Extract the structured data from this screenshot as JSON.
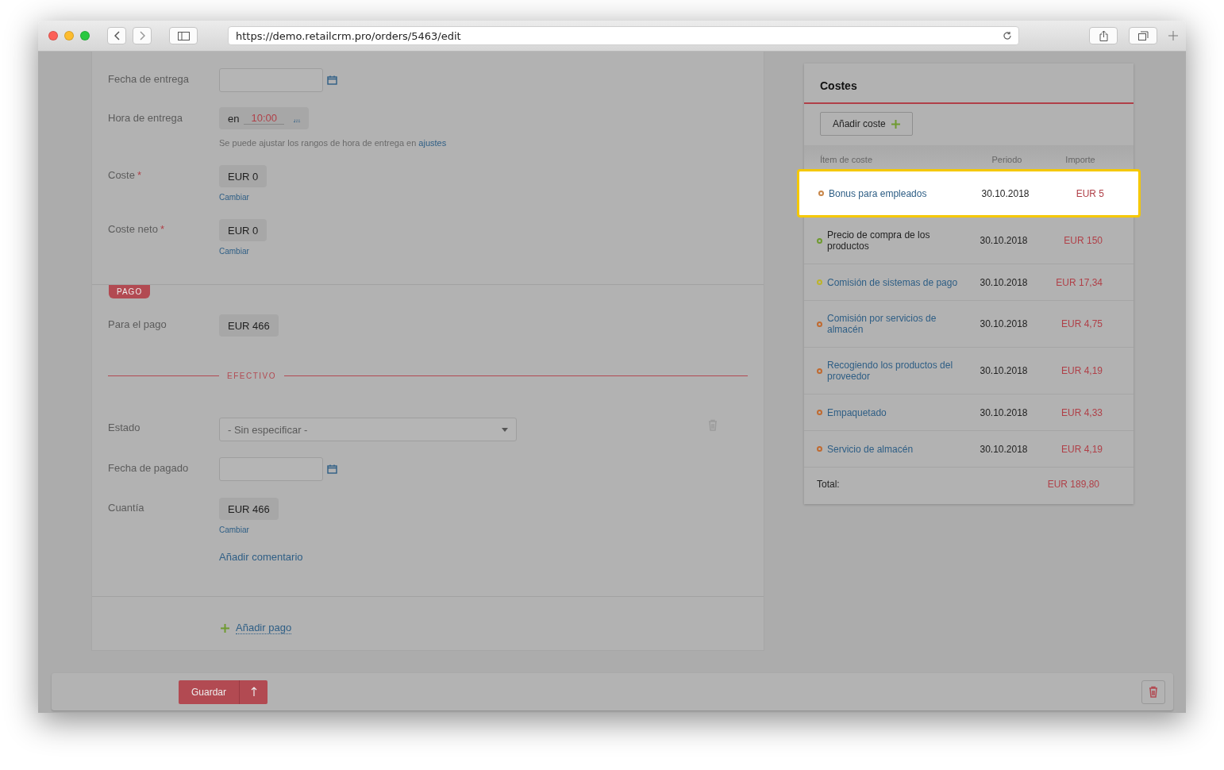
{
  "browser": {
    "url": "https://demo.retailcrm.pro/orders/5463/edit"
  },
  "delivery": [
    {
      "kind": "date",
      "label": "Fecha de entrega"
    },
    {
      "kind": "time",
      "label": "Hora de entrega",
      "prefix": "en",
      "value": "10:00",
      "more": "...",
      "hint": "Se puede ajustar los rangos de hora de entrega en",
      "hint_link": "ajustes"
    },
    {
      "kind": "money",
      "label": "Coste",
      "required_mark": "*",
      "value": "EUR 0",
      "action": "Cambiar"
    },
    {
      "kind": "money",
      "label": "Coste neto",
      "required_mark": "*",
      "value": "EUR 0",
      "action": "Cambiar"
    }
  ],
  "payment": {
    "tag": "PAGO",
    "summary": [
      {
        "kind": "money",
        "label": "Para el pago",
        "value": "EUR 466"
      }
    ],
    "method": "EFECTIVO",
    "fields": [
      {
        "kind": "select",
        "label": "Estado",
        "value": "- Sin especificar -"
      },
      {
        "kind": "date",
        "label": "Fecha de pagado"
      },
      {
        "kind": "money",
        "label": "Cuantía",
        "value": "EUR 466",
        "action": "Cambiar"
      }
    ],
    "comment_link": "Añadir comentario",
    "add_payment": "Añadir pago"
  },
  "costs": {
    "title": "Costes",
    "add_button": "Añadir coste",
    "columns": [
      "Ítem de coste",
      "Periodo",
      "Importe"
    ],
    "rows": [
      {
        "kind": "link",
        "name": "Bonus para empleados",
        "period": "30.10.2018",
        "amount": "EUR 5",
        "color": "#c8874a",
        "selected": true
      },
      {
        "kind": "text",
        "name": "Precio de compra de los productos",
        "period": "30.10.2018",
        "amount": "EUR 150",
        "color": "#6f9a30",
        "selected": false
      },
      {
        "kind": "link",
        "name": "Comisión de sistemas de pago",
        "period": "30.10.2018",
        "amount": "EUR 17,34",
        "color": "#bdb42a",
        "selected": false
      },
      {
        "kind": "link",
        "name": "Comisión por servicios de almacén",
        "period": "30.10.2018",
        "amount": "EUR 4,75",
        "color": "#c06a30",
        "selected": false
      },
      {
        "kind": "link",
        "name": "Recogiendo los productos del proveedor",
        "period": "30.10.2018",
        "amount": "EUR 4,19",
        "color": "#c06a30",
        "selected": false
      },
      {
        "kind": "link",
        "name": "Empaquetado",
        "period": "30.10.2018",
        "amount": "EUR 4,33",
        "color": "#c06a30",
        "selected": false
      },
      {
        "kind": "link",
        "name": "Servicio de almacén",
        "period": "30.10.2018",
        "amount": "EUR 4,19",
        "color": "#c06a30",
        "selected": false
      }
    ],
    "total_label": "Total:",
    "total": "EUR 189,80"
  },
  "footer": {
    "save": "Guardar"
  }
}
